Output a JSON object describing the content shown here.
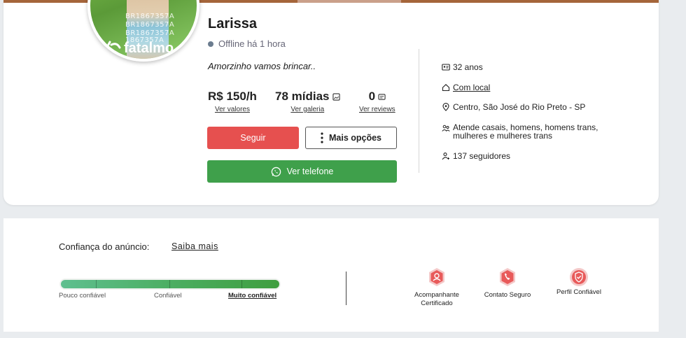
{
  "profile": {
    "name": "Larissa",
    "status": "Offline há 1 hora",
    "bio": "Amorzinho vamos brincar..",
    "avatar": {
      "watermark_lines": [
        "BR1867357A",
        "BR1867357A",
        "BR1867357A",
        "1867357A"
      ],
      "brand_text": "fatalmo"
    },
    "stats": {
      "price": "R$ 150/h",
      "price_link": "Ver valores",
      "media": "78 mídias",
      "media_link": "Ver galeria",
      "reviews": "0",
      "reviews_link": "Ver reviews"
    },
    "buttons": {
      "follow": "Seguir",
      "more": "Mais opções",
      "phone": "Ver telefone"
    },
    "info": {
      "age": "32 anos",
      "place": "Com local",
      "location": "Centro, São José do Rio Preto - SP",
      "serves": "Atende casais, homens, homens trans, mulheres e mulheres trans",
      "followers": "137 seguidores"
    }
  },
  "trust": {
    "title": "Confiança do anúncio:",
    "learn_more": "Saiba mais",
    "level": 1.0,
    "labels": {
      "low": "Pouco confiável",
      "mid": "Confiável",
      "high": "Muito confiável"
    },
    "badges": {
      "certified": "Acompanhante Certificado",
      "contact": "Contato Seguro",
      "profile": "Perfil Confiável"
    }
  },
  "colors": {
    "follow": "#e6504f",
    "phone": "#3fa04b",
    "badge": "#e85a5a"
  }
}
